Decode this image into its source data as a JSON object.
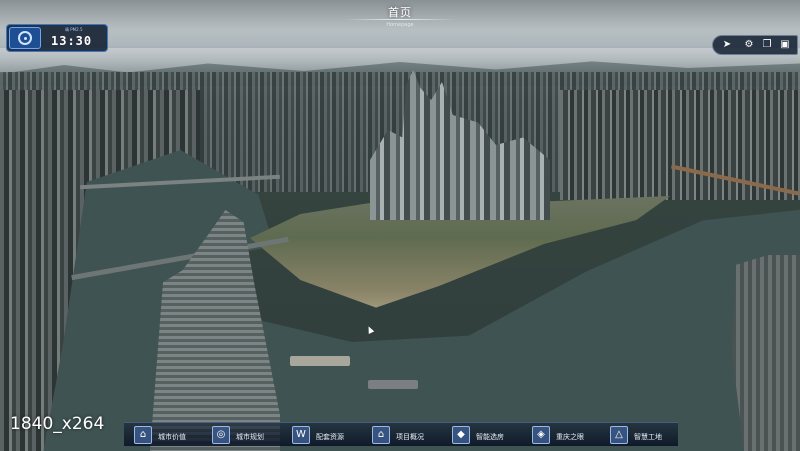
{
  "header": {
    "title": "首页",
    "subtitle": "Homepage"
  },
  "clock": {
    "time": "13:30",
    "weather": "晴 PM2.5",
    "icon": "compass-icon"
  },
  "top_right_tools": [
    {
      "name": "send-icon",
      "glyph": "➤"
    },
    {
      "name": "gear-icon",
      "glyph": "⚙"
    },
    {
      "name": "copy-icon",
      "glyph": "❐"
    },
    {
      "name": "window-icon",
      "glyph": "▣"
    }
  ],
  "nav": {
    "items": [
      {
        "label": "城市价值",
        "icon": "city-value-icon",
        "glyph": "⌂"
      },
      {
        "label": "城市规划",
        "icon": "city-plan-icon",
        "glyph": "◎"
      },
      {
        "label": "配套资源",
        "icon": "resources-icon",
        "glyph": "W"
      },
      {
        "label": "项目概况",
        "icon": "project-icon",
        "glyph": "⌂"
      },
      {
        "label": "智能选房",
        "icon": "house-select-icon",
        "glyph": "◆"
      },
      {
        "label": "重庆之眼",
        "icon": "eye-icon",
        "glyph": "◈"
      },
      {
        "label": "智慧工地",
        "icon": "worksite-icon",
        "glyph": "△"
      }
    ]
  },
  "overlay": {
    "resolution_text": "1840_x264"
  },
  "colors": {
    "panel_bg": "#121e30",
    "accent": "#3b78c4",
    "water": "#3f5352"
  }
}
